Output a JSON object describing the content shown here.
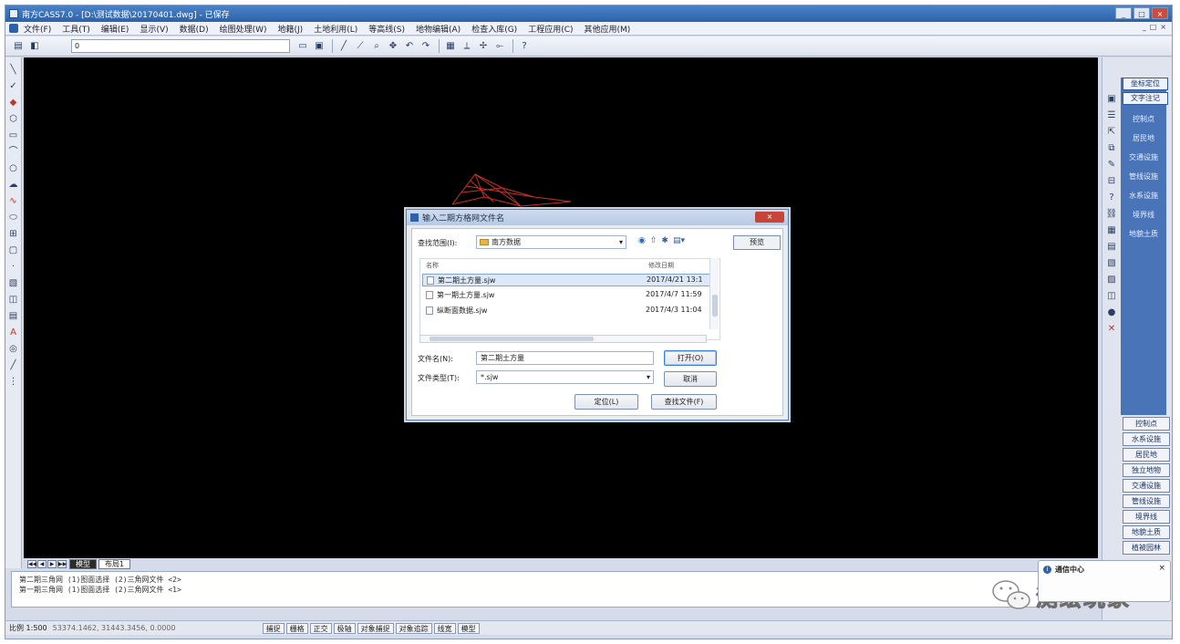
{
  "window": {
    "title": "南方CASS7.0 - [D:\\测试数据\\20170401.dwg] - 已保存",
    "buttons": [
      "_",
      "□",
      "×"
    ]
  },
  "menu": {
    "items": [
      "文件(F)",
      "工具(T)",
      "编辑(E)",
      "显示(V)",
      "数据(D)",
      "绘图处理(W)",
      "地籍(J)",
      "土地利用(L)",
      "等高线(S)",
      "地物编辑(A)",
      "检查入库(G)",
      "工程应用(C)",
      "其他应用(M)"
    ],
    "mdi": [
      "_",
      "□",
      "×"
    ]
  },
  "toolbar": {
    "layer": "0",
    "icons": [
      "open-icon",
      "save-icon",
      "line-icon",
      "polyline-icon",
      "zoom-icon",
      "pan-icon",
      "undo-icon",
      "redo-icon",
      "grid-icon",
      "measure-icon",
      "help-icon"
    ]
  },
  "right_panel": {
    "top_buttons": [
      "坐标定位",
      "文字注记"
    ],
    "items": [
      "控制点",
      "居民地",
      "交通设施",
      "管线设施",
      "水系设施",
      "境界线",
      "地貌土质"
    ],
    "bottom_buttons": [
      "控制点",
      "水系设施",
      "居民地",
      "独立地物",
      "交通设施",
      "管线设施",
      "境界线",
      "地貌土质",
      "植被园林"
    ]
  },
  "tabs": {
    "nav": [
      "◀◀",
      "◀",
      "▶",
      "▶▶"
    ],
    "items": [
      "模型",
      "布局1"
    ]
  },
  "command": {
    "lines": [
      "第二期三角网 (1)图面选择 (2)三角网文件 <2>",
      "第一期三角网 (1)图面选择 (2)三角网文件 <1>"
    ]
  },
  "notification": {
    "title": "通信中心",
    "close": "×"
  },
  "watermark": {
    "text": "测绘玩家"
  },
  "statusbar": {
    "scale": "比例 1:500",
    "coords": "53374.1462, 31443.3456, 0.0000",
    "toggles": [
      "捕捉",
      "栅格",
      "正交",
      "极轴",
      "对象捕捉",
      "对象追踪",
      "线宽",
      "模型"
    ]
  },
  "dialog": {
    "title": "输入二期方格网文件名",
    "close": "×",
    "lookin_label": "查找范围(I):",
    "lookin_value": "南方数据",
    "preview": "预览",
    "col_name": "名称",
    "col_date": "修改日期",
    "files": [
      {
        "name": "第二期土方量.sjw",
        "date": "2017/4/21 13:1"
      },
      {
        "name": "第一期土方量.sjw",
        "date": "2017/4/7 11:59"
      },
      {
        "name": "纵断面数据.sjw",
        "date": "2017/4/3 11:04"
      }
    ],
    "filename_label": "文件名(N):",
    "filename_value": "第二期土方量",
    "filetype_label": "文件类型(T):",
    "filetype_value": "*.sjw",
    "open_button": "打开(O)",
    "cancel_button": "取消",
    "locate_button": "定位(L)",
    "find_button": "查找文件(F)"
  },
  "colors": {
    "canvas": "#000000",
    "accent": "#2d62a8",
    "panel_blue": "#4a74b8",
    "drawing_red": "#c8322a"
  }
}
